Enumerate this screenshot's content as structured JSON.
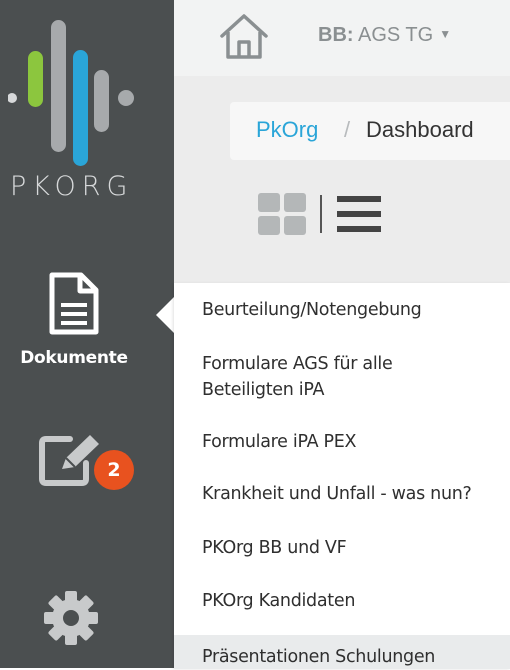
{
  "logo": {
    "text": "PKORG"
  },
  "sidebar": {
    "documents": {
      "label": "Dokumente",
      "icon": "document-icon"
    },
    "edits": {
      "icon": "edit-icon",
      "badge": "2",
      "badge_color": "#e8521f"
    },
    "settings": {
      "icon": "gear-icon"
    }
  },
  "header": {
    "home_icon": "home-icon",
    "org_prefix": "BB:",
    "org_name": "AGS TG"
  },
  "breadcrumb": {
    "root": "PkOrg",
    "separator": "/",
    "current": "Dashboard"
  },
  "view_toggle": {
    "grid_icon": "grid-view-icon",
    "list_icon": "list-view-icon"
  },
  "dropdown": {
    "items": [
      "Beurteilung/Notengebung",
      "Formulare AGS für alle",
      "Beteiligten iPA",
      "Formulare iPA PEX",
      "Krankheit und Unfall - was nun?",
      "PKOrg BB und VF",
      "PKOrg Kandidaten",
      "Präsentationen Schulungen"
    ]
  },
  "colors": {
    "sidebar_bg": "#4b4f50",
    "accent_blue": "#2aa5d8",
    "accent_green": "#8cc63e",
    "badge_orange": "#e8521f"
  }
}
